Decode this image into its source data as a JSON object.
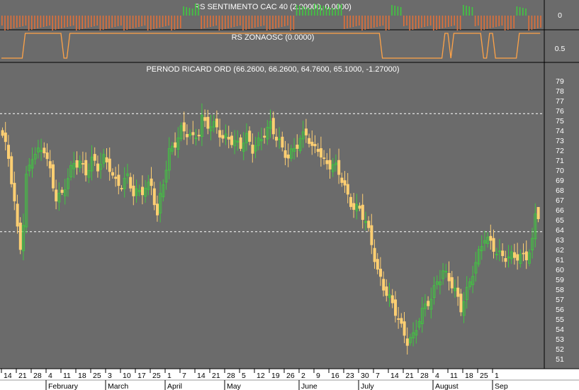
{
  "colors": {
    "background": "#6b6b6b",
    "axis_background": "#ffffff",
    "up_candle": "#40c840",
    "down_candle": "#ffcf72",
    "sentiment_positive": "#40c840",
    "sentiment_negative": "#e0703a",
    "oscillator_line": "#ffa347",
    "reference_line": "#ffffff"
  },
  "chart_data": [
    {
      "type": "bar",
      "title": "RS SENTIMENTO CAC 40 (2.00000, 0.0000)",
      "y_ticks": [
        "0"
      ],
      "ylim": [
        -1,
        1
      ],
      "grid": false,
      "segments": [
        {
          "from_index": 0,
          "to_index": 60,
          "sign": -1
        },
        {
          "from_index": 61,
          "to_index": 66,
          "sign": 1
        },
        {
          "from_index": 67,
          "to_index": 98,
          "sign": -1
        },
        {
          "from_index": 99,
          "to_index": 114,
          "sign": 1
        },
        {
          "from_index": 115,
          "to_index": 130,
          "sign": -1
        },
        {
          "from_index": 131,
          "to_index": 134,
          "sign": 1
        },
        {
          "from_index": 135,
          "to_index": 154,
          "sign": -1
        },
        {
          "from_index": 155,
          "to_index": 158,
          "sign": 1
        },
        {
          "from_index": 159,
          "to_index": 172,
          "sign": -1
        },
        {
          "from_index": 173,
          "to_index": 176,
          "sign": 1
        },
        {
          "from_index": 177,
          "to_index": 195,
          "sign": -1
        },
        {
          "from_index": 196,
          "to_index": 200,
          "sign": 1
        }
      ]
    },
    {
      "type": "line",
      "title": "RS ZONAOSC (0.0000)",
      "y_ticks": [
        "0.5"
      ],
      "ylim": [
        0,
        1
      ],
      "series": [
        {
          "values_by_range": [
            {
              "from_index": 0,
              "to_index": 7,
              "value": 0
            },
            {
              "from_index": 8,
              "to_index": 20,
              "value": 1
            },
            {
              "from_index": 21,
              "to_index": 22,
              "value": 0
            },
            {
              "from_index": 23,
              "to_index": 127,
              "value": 1
            },
            {
              "from_index": 128,
              "to_index": 148,
              "value": 0
            },
            {
              "from_index": 149,
              "to_index": 150,
              "value": 1
            },
            {
              "from_index": 151,
              "to_index": 151,
              "value": 0
            },
            {
              "from_index": 152,
              "to_index": 161,
              "value": 1
            },
            {
              "from_index": 162,
              "to_index": 163,
              "value": 0
            },
            {
              "from_index": 164,
              "to_index": 165,
              "value": 1
            },
            {
              "from_index": 166,
              "to_index": 173,
              "value": 0
            },
            {
              "from_index": 174,
              "to_index": 186,
              "value": 1
            },
            {
              "from_index": 187,
              "to_index": 200,
              "value": 0
            }
          ]
        }
      ]
    },
    {
      "type": "candlestick",
      "title": "PERNOD RICARD ORD (66.2600, 66.2600, 64.7600, 65.1000, -1.27000)",
      "ylim": [
        50,
        80
      ],
      "y_ticks": [
        51,
        52,
        53,
        54,
        55,
        56,
        57,
        58,
        59,
        60,
        61,
        62,
        63,
        64,
        65,
        66,
        67,
        68,
        69,
        70,
        71,
        72,
        73,
        74,
        75,
        76,
        77,
        78,
        79
      ],
      "horizontal_lines": [
        75.7,
        63.8
      ],
      "grid": false,
      "x_tick_labels": [
        "14",
        "21",
        "28",
        "4",
        "11",
        "18",
        "25",
        "3",
        "10",
        "17",
        "25",
        "1",
        "7",
        "14",
        "21",
        "28",
        "5",
        "12",
        "19",
        "26",
        "2",
        "9",
        "16",
        "23",
        "30",
        "7",
        "14",
        "21",
        "28",
        "4",
        "11",
        "18",
        "25",
        "1"
      ],
      "x_tick_index": [
        0,
        5,
        10,
        15,
        20,
        25,
        30,
        35,
        40,
        45,
        50,
        55,
        60,
        65,
        70,
        75,
        80,
        85,
        90,
        95,
        100,
        105,
        110,
        115,
        120,
        125,
        130,
        135,
        140,
        145,
        150,
        155,
        160,
        165
      ],
      "month_labels": [
        "February",
        "March",
        "April",
        "May",
        "June",
        "July",
        "August",
        "Sep"
      ],
      "month_label_index": [
        15,
        35,
        55,
        75,
        100,
        120,
        145,
        165
      ],
      "close_anchors": [
        [
          0,
          73.5
        ],
        [
          2,
          71
        ],
        [
          4,
          66.5
        ],
        [
          5,
          64
        ],
        [
          6,
          62.5
        ],
        [
          7,
          65
        ],
        [
          8,
          69.5
        ],
        [
          10,
          71.5
        ],
        [
          12,
          71.5
        ],
        [
          14,
          72
        ],
        [
          16,
          70
        ],
        [
          18,
          67.5
        ],
        [
          20,
          67.5
        ],
        [
          22,
          69
        ],
        [
          24,
          70.5
        ],
        [
          26,
          71
        ],
        [
          28,
          70
        ],
        [
          30,
          71
        ],
        [
          32,
          70
        ],
        [
          34,
          71
        ],
        [
          36,
          70.5
        ],
        [
          38,
          69
        ],
        [
          40,
          68.5
        ],
        [
          42,
          69
        ],
        [
          44,
          67.5
        ],
        [
          46,
          68
        ],
        [
          48,
          68.5
        ],
        [
          50,
          68.5
        ],
        [
          52,
          65
        ],
        [
          53,
          67
        ],
        [
          56,
          72
        ],
        [
          58,
          73
        ],
        [
          60,
          74
        ],
        [
          62,
          73.5
        ],
        [
          64,
          73
        ],
        [
          66,
          74
        ],
        [
          67,
          75.5
        ],
        [
          68,
          75
        ],
        [
          70,
          74.5
        ],
        [
          72,
          74
        ],
        [
          74,
          73
        ],
        [
          76,
          73.5
        ],
        [
          78,
          73
        ],
        [
          80,
          72.5
        ],
        [
          82,
          73
        ],
        [
          84,
          72
        ],
        [
          86,
          73
        ],
        [
          88,
          74
        ],
        [
          90,
          74.5
        ],
        [
          92,
          73
        ],
        [
          94,
          72
        ],
        [
          96,
          71.5
        ],
        [
          98,
          72.5
        ],
        [
          100,
          73
        ],
        [
          102,
          73.5
        ],
        [
          104,
          72
        ],
        [
          106,
          72.5
        ],
        [
          108,
          71
        ],
        [
          110,
          70.5
        ],
        [
          112,
          70
        ],
        [
          114,
          69
        ],
        [
          116,
          67.5
        ],
        [
          118,
          66.5
        ],
        [
          120,
          66
        ],
        [
          122,
          64.5
        ],
        [
          124,
          62.5
        ],
        [
          126,
          60
        ],
        [
          128,
          58.5
        ],
        [
          130,
          57
        ],
        [
          132,
          55.5
        ],
        [
          134,
          54
        ],
        [
          136,
          53
        ],
        [
          138,
          53.5
        ],
        [
          140,
          55
        ],
        [
          142,
          56
        ],
        [
          144,
          57
        ],
        [
          146,
          59
        ],
        [
          148,
          60
        ],
        [
          150,
          59
        ],
        [
          152,
          57.5
        ],
        [
          154,
          56
        ],
        [
          156,
          58
        ],
        [
          158,
          60
        ],
        [
          160,
          61.5
        ],
        [
          162,
          63
        ],
        [
          164,
          62.5
        ],
        [
          166,
          62
        ],
        [
          168,
          61.5
        ],
        [
          170,
          61.2
        ],
        [
          172,
          61
        ],
        [
          174,
          61.2
        ],
        [
          176,
          61.5
        ],
        [
          178,
          63
        ],
        [
          179,
          65.5
        ],
        [
          180,
          65.1
        ]
      ],
      "last_bar": {
        "open": 66.26,
        "high": 66.26,
        "low": 64.76,
        "close": 65.1,
        "change": -1.27
      }
    }
  ]
}
